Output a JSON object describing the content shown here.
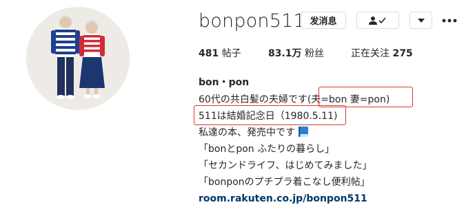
{
  "profile": {
    "username": "bonpon511",
    "buttons": {
      "message": "发消息"
    },
    "stats": {
      "posts_count": "481",
      "posts_label": "帖子",
      "followers_count": "83.1万",
      "followers_label": "粉丝",
      "following_label": "正在关注",
      "following_count": "275"
    },
    "bio": {
      "name": "bon・pon",
      "line1_main": "60代の共白髪の夫婦です",
      "line1_boxed": "(夫=bon 妻=pon)",
      "line2": "511は結婚記念日（1980.5.11)",
      "line3": "私達の本、発売中です",
      "line4": "「bonとpon ふたりの暮らし」",
      "line5": "「セカンドライフ、はじめてみました」",
      "line6": "「bonponのプチプラ着こなし便利帖」",
      "link": "room.rakuten.co.jp/bonpon511"
    },
    "colors": {
      "highlight": "#e0342c",
      "link": "#00376b",
      "book_icon": "#2a7fd4"
    },
    "icons": {
      "follow": "person-check-icon",
      "dropdown": "triangle-down-icon",
      "more": "more-dots-icon",
      "book": "blue-book-icon"
    }
  }
}
